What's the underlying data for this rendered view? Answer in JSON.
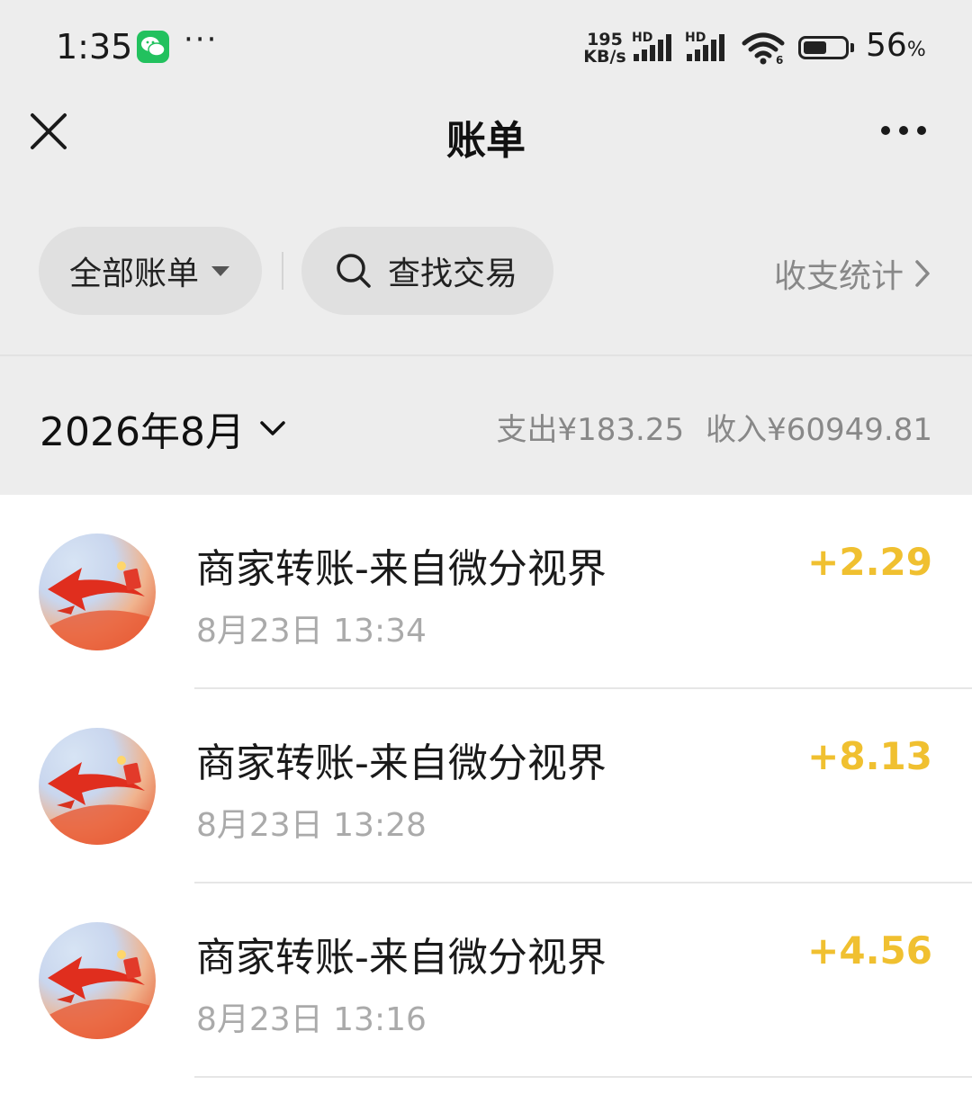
{
  "status_bar": {
    "time": "1:35",
    "more": "···",
    "net_speed_value": "195",
    "net_speed_unit": "KB/s",
    "hd_label": "HD",
    "wifi_badge": "6",
    "battery_percent": "56",
    "battery_unit": "%",
    "battery_level": 0.56
  },
  "header": {
    "title": "账单"
  },
  "filters": {
    "all_bills": "全部账单",
    "search": "查找交易",
    "stats": "收支统计"
  },
  "month": {
    "label": "2026年8月",
    "expense": "支出¥183.25",
    "income": "收入¥60949.81"
  },
  "transactions": [
    {
      "title": "商家转账-来自微分视界",
      "time": "8月23日 13:34",
      "amount": "+2.29"
    },
    {
      "title": "商家转账-来自微分视界",
      "time": "8月23日 13:28",
      "amount": "+8.13"
    },
    {
      "title": "商家转账-来自微分视界",
      "time": "8月23日 13:16",
      "amount": "+4.56"
    }
  ],
  "colors": {
    "background": "#ededed",
    "income_amount": "#f0c030",
    "wechat_green": "#22c15e"
  },
  "icons": {
    "close": "close-icon",
    "more": "more-icon",
    "search": "search-icon",
    "chevron_right": "chevron-right-icon",
    "chevron_down": "chevron-down-icon"
  }
}
